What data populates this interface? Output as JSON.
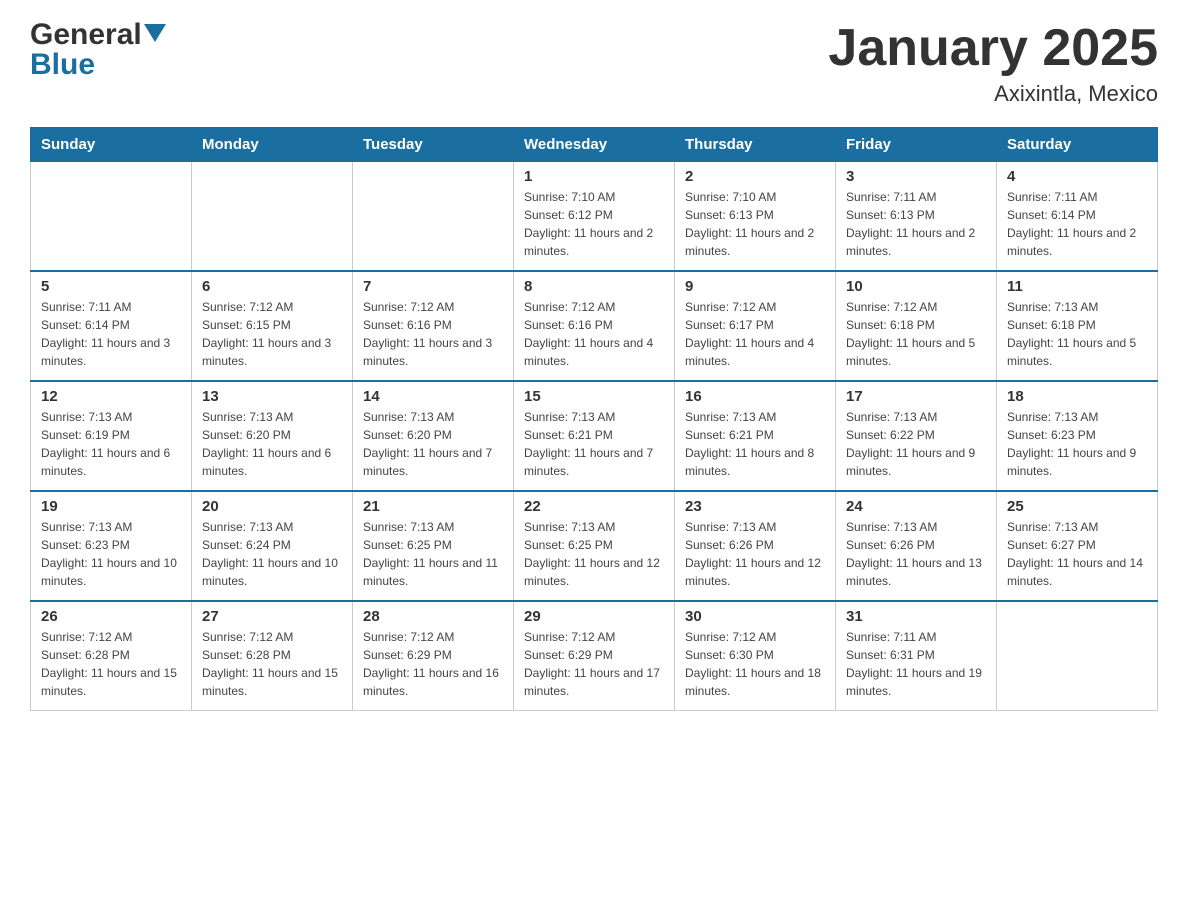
{
  "header": {
    "title": "January 2025",
    "subtitle": "Axixintla, Mexico",
    "logo_general": "General",
    "logo_blue": "Blue"
  },
  "days_of_week": [
    "Sunday",
    "Monday",
    "Tuesday",
    "Wednesday",
    "Thursday",
    "Friday",
    "Saturday"
  ],
  "weeks": [
    [
      {
        "day": "",
        "info": ""
      },
      {
        "day": "",
        "info": ""
      },
      {
        "day": "",
        "info": ""
      },
      {
        "day": "1",
        "info": "Sunrise: 7:10 AM\nSunset: 6:12 PM\nDaylight: 11 hours and 2 minutes."
      },
      {
        "day": "2",
        "info": "Sunrise: 7:10 AM\nSunset: 6:13 PM\nDaylight: 11 hours and 2 minutes."
      },
      {
        "day": "3",
        "info": "Sunrise: 7:11 AM\nSunset: 6:13 PM\nDaylight: 11 hours and 2 minutes."
      },
      {
        "day": "4",
        "info": "Sunrise: 7:11 AM\nSunset: 6:14 PM\nDaylight: 11 hours and 2 minutes."
      }
    ],
    [
      {
        "day": "5",
        "info": "Sunrise: 7:11 AM\nSunset: 6:14 PM\nDaylight: 11 hours and 3 minutes."
      },
      {
        "day": "6",
        "info": "Sunrise: 7:12 AM\nSunset: 6:15 PM\nDaylight: 11 hours and 3 minutes."
      },
      {
        "day": "7",
        "info": "Sunrise: 7:12 AM\nSunset: 6:16 PM\nDaylight: 11 hours and 3 minutes."
      },
      {
        "day": "8",
        "info": "Sunrise: 7:12 AM\nSunset: 6:16 PM\nDaylight: 11 hours and 4 minutes."
      },
      {
        "day": "9",
        "info": "Sunrise: 7:12 AM\nSunset: 6:17 PM\nDaylight: 11 hours and 4 minutes."
      },
      {
        "day": "10",
        "info": "Sunrise: 7:12 AM\nSunset: 6:18 PM\nDaylight: 11 hours and 5 minutes."
      },
      {
        "day": "11",
        "info": "Sunrise: 7:13 AM\nSunset: 6:18 PM\nDaylight: 11 hours and 5 minutes."
      }
    ],
    [
      {
        "day": "12",
        "info": "Sunrise: 7:13 AM\nSunset: 6:19 PM\nDaylight: 11 hours and 6 minutes."
      },
      {
        "day": "13",
        "info": "Sunrise: 7:13 AM\nSunset: 6:20 PM\nDaylight: 11 hours and 6 minutes."
      },
      {
        "day": "14",
        "info": "Sunrise: 7:13 AM\nSunset: 6:20 PM\nDaylight: 11 hours and 7 minutes."
      },
      {
        "day": "15",
        "info": "Sunrise: 7:13 AM\nSunset: 6:21 PM\nDaylight: 11 hours and 7 minutes."
      },
      {
        "day": "16",
        "info": "Sunrise: 7:13 AM\nSunset: 6:21 PM\nDaylight: 11 hours and 8 minutes."
      },
      {
        "day": "17",
        "info": "Sunrise: 7:13 AM\nSunset: 6:22 PM\nDaylight: 11 hours and 9 minutes."
      },
      {
        "day": "18",
        "info": "Sunrise: 7:13 AM\nSunset: 6:23 PM\nDaylight: 11 hours and 9 minutes."
      }
    ],
    [
      {
        "day": "19",
        "info": "Sunrise: 7:13 AM\nSunset: 6:23 PM\nDaylight: 11 hours and 10 minutes."
      },
      {
        "day": "20",
        "info": "Sunrise: 7:13 AM\nSunset: 6:24 PM\nDaylight: 11 hours and 10 minutes."
      },
      {
        "day": "21",
        "info": "Sunrise: 7:13 AM\nSunset: 6:25 PM\nDaylight: 11 hours and 11 minutes."
      },
      {
        "day": "22",
        "info": "Sunrise: 7:13 AM\nSunset: 6:25 PM\nDaylight: 11 hours and 12 minutes."
      },
      {
        "day": "23",
        "info": "Sunrise: 7:13 AM\nSunset: 6:26 PM\nDaylight: 11 hours and 12 minutes."
      },
      {
        "day": "24",
        "info": "Sunrise: 7:13 AM\nSunset: 6:26 PM\nDaylight: 11 hours and 13 minutes."
      },
      {
        "day": "25",
        "info": "Sunrise: 7:13 AM\nSunset: 6:27 PM\nDaylight: 11 hours and 14 minutes."
      }
    ],
    [
      {
        "day": "26",
        "info": "Sunrise: 7:12 AM\nSunset: 6:28 PM\nDaylight: 11 hours and 15 minutes."
      },
      {
        "day": "27",
        "info": "Sunrise: 7:12 AM\nSunset: 6:28 PM\nDaylight: 11 hours and 15 minutes."
      },
      {
        "day": "28",
        "info": "Sunrise: 7:12 AM\nSunset: 6:29 PM\nDaylight: 11 hours and 16 minutes."
      },
      {
        "day": "29",
        "info": "Sunrise: 7:12 AM\nSunset: 6:29 PM\nDaylight: 11 hours and 17 minutes."
      },
      {
        "day": "30",
        "info": "Sunrise: 7:12 AM\nSunset: 6:30 PM\nDaylight: 11 hours and 18 minutes."
      },
      {
        "day": "31",
        "info": "Sunrise: 7:11 AM\nSunset: 6:31 PM\nDaylight: 11 hours and 19 minutes."
      },
      {
        "day": "",
        "info": ""
      }
    ]
  ]
}
